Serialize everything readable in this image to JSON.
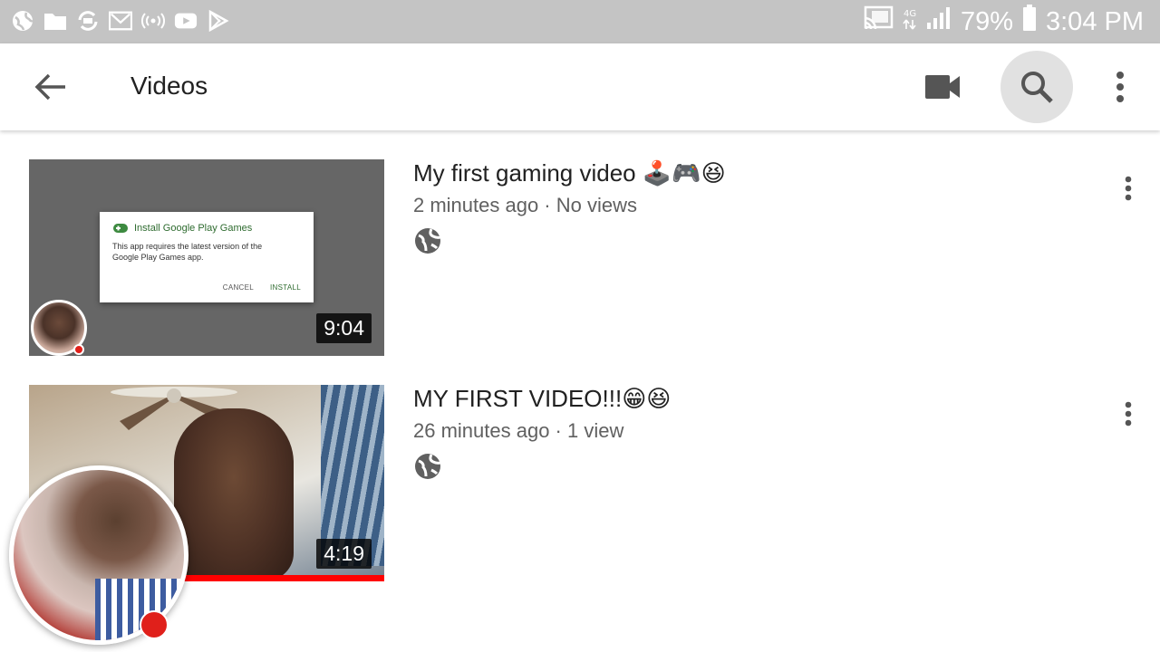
{
  "status_bar": {
    "battery": "79%",
    "time": "3:04 PM",
    "left_icons": [
      "browser-icon",
      "folder-icon",
      "sync-icon",
      "gmail-icon",
      "wireless-icon",
      "youtube-icon",
      "play-store-icon"
    ],
    "right_icons": [
      "cast-icon",
      "network-4g-icon",
      "signal-icon",
      "battery-icon"
    ]
  },
  "app_bar": {
    "title": "Videos",
    "icons": [
      "back-arrow-icon",
      "video-camera-icon",
      "search-icon",
      "more-vert-icon"
    ]
  },
  "videos": [
    {
      "title": "My first gaming video 🕹️🎮😆",
      "meta": "2 minutes ago · No views",
      "duration": "9:04",
      "visibility_icon": "globe-icon",
      "thumbnail_dialog": {
        "title": "Install Google Play Games",
        "body": "This app requires the latest version of the Google Play Games app.",
        "cancel": "CANCEL",
        "install": "INSTALL"
      }
    },
    {
      "title": "MY FIRST VIDEO!!!😁😆",
      "meta": "26 minutes ago · 1 view",
      "duration": "4:19",
      "visibility_icon": "globe-icon"
    }
  ],
  "colors": {
    "status_bar": "#c4c4c4",
    "recording_red": "#e0201b",
    "progress_red": "#ff0000",
    "search_highlight": "#e1e1e1"
  }
}
